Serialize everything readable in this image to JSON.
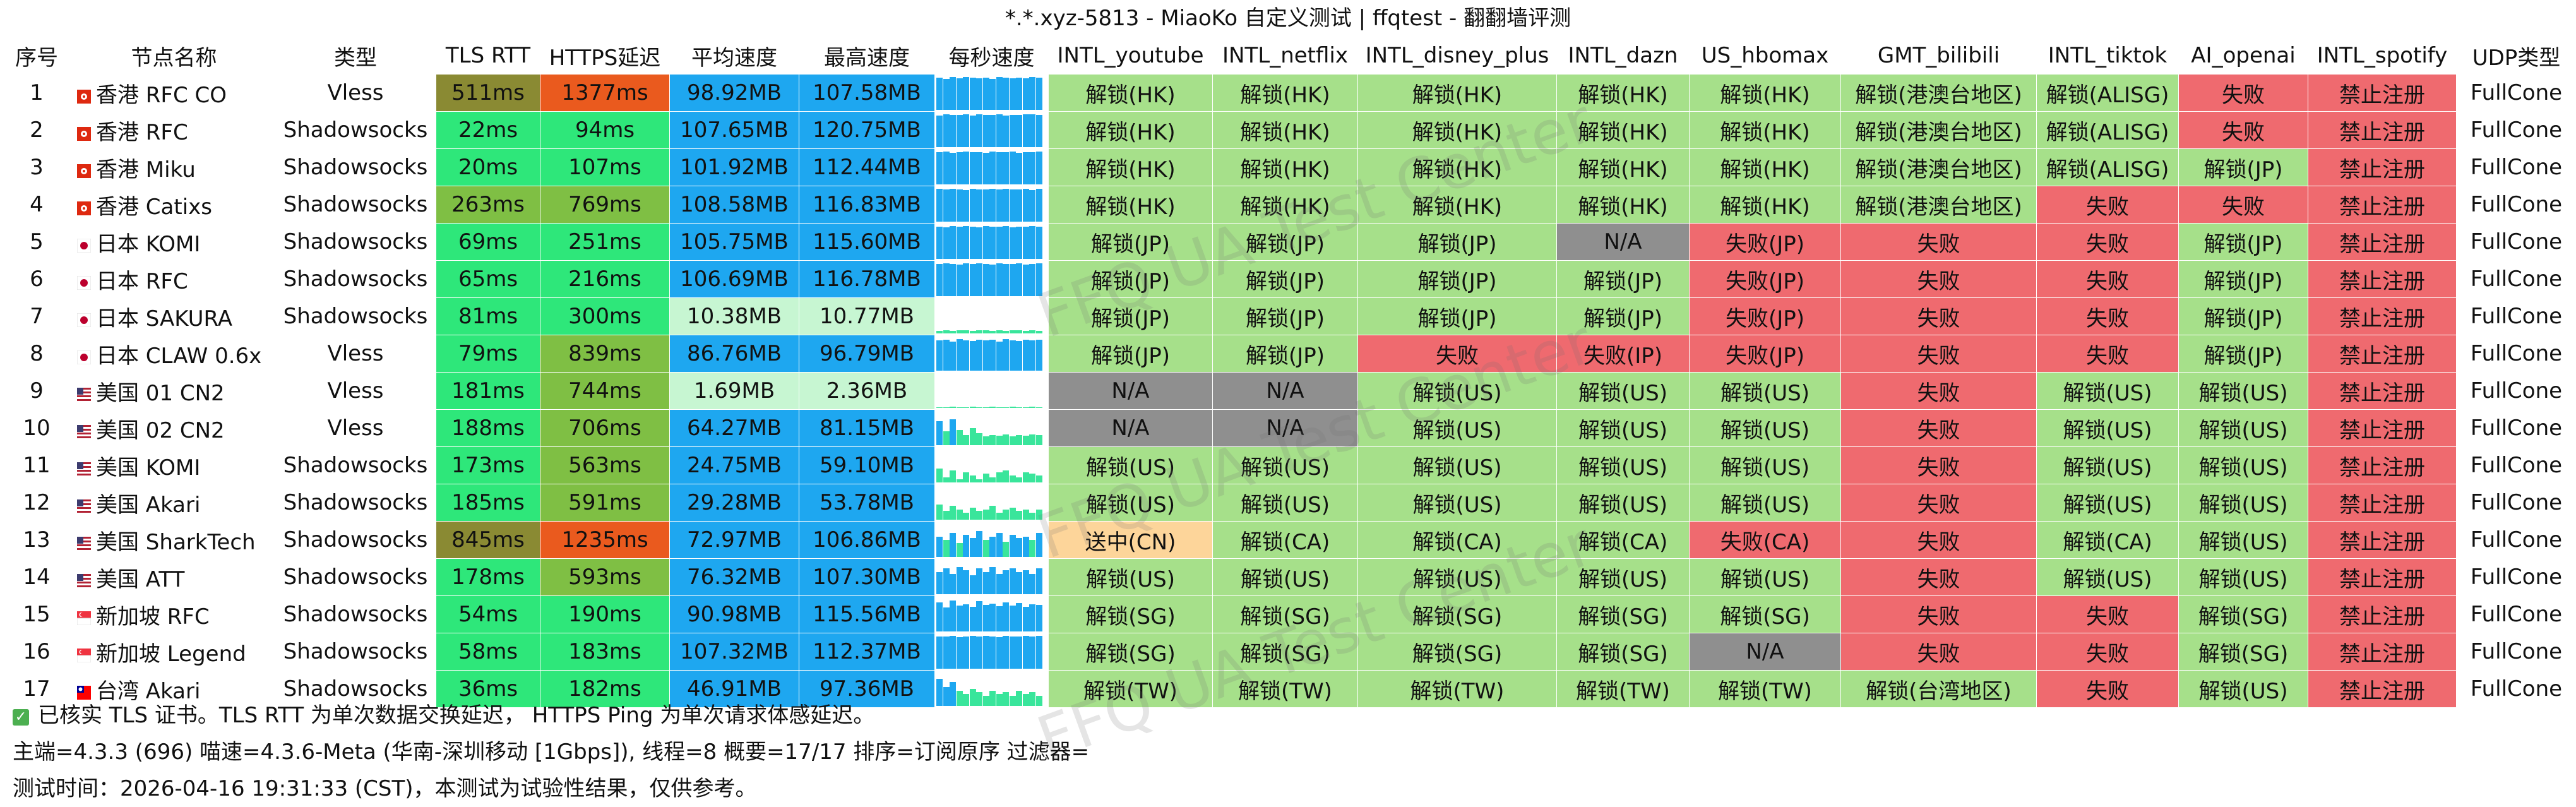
{
  "title": "*.*.xyz-5813 - MiaoKo 自定义测试 | ffqtest - 翻翻墙评测",
  "watermark": "FFQ UA Test Center",
  "colors": {
    "green_unlock": "#a6e08a",
    "red_fail": "#ef6a6f",
    "gray_na": "#8f8f8f",
    "orange_pending": "#fdd59a",
    "rtt_low": "#2ee77a",
    "rtt_mid": "#7fbf44",
    "rtt_high": "#8a8a33",
    "https_low": "#2ee77a",
    "https_mid": "#7fbf44",
    "https_high": "#ea5a1e",
    "speed_high": "#1ea7f0",
    "speed_low": "#c7f6d2",
    "spark_fast": "#1ea7f0",
    "spark_slow": "#39e59b"
  },
  "columns": [
    "序号",
    "节点名称",
    "类型",
    "TLS RTT",
    "HTTPS延迟",
    "平均速度",
    "最高速度",
    "每秒速度",
    "INTL_youtube",
    "INTL_netflix",
    "INTL_disney_plus",
    "INTL_dazn",
    "US_hbomax",
    "GMT_bilibili",
    "INTL_tiktok",
    "AI_openai",
    "INTL_spotify",
    "UDP类型"
  ],
  "rows": [
    {
      "idx": "1",
      "name": "香港 RFC CO",
      "flag": "hk-flag-icon",
      "type": "Vless",
      "rtt": "511ms",
      "rtt_level": "high",
      "https": "1377ms",
      "https_level": "high",
      "avg": "98.92MB",
      "max": "107.58MB",
      "speed_level": "high",
      "spark": [
        0.95,
        0.9,
        0.96,
        0.92,
        0.97,
        0.94,
        0.93,
        0.95,
        0.91,
        0.96,
        0.94,
        0.93,
        0.95,
        0.92,
        0.96,
        0.94
      ],
      "unlocks": [
        "解锁(HK)",
        "解锁(HK)",
        "解锁(HK)",
        "解锁(HK)",
        "解锁(HK)",
        "解锁(港澳台地区)",
        "解锁(ALISG)",
        "失败",
        "禁止注册"
      ],
      "udp": "FullCone"
    },
    {
      "idx": "2",
      "name": "香港 RFC",
      "flag": "hk-flag-icon",
      "type": "Shadowsocks",
      "rtt": "22ms",
      "rtt_level": "low",
      "https": "94ms",
      "https_level": "low",
      "avg": "107.65MB",
      "max": "120.75MB",
      "speed_level": "high",
      "spark": [
        0.92,
        0.97,
        0.94,
        0.95,
        0.96,
        0.93,
        0.97,
        0.94,
        0.95,
        0.96,
        0.93,
        0.95,
        0.94,
        0.96,
        0.97,
        0.95
      ],
      "unlocks": [
        "解锁(HK)",
        "解锁(HK)",
        "解锁(HK)",
        "解锁(HK)",
        "解锁(HK)",
        "解锁(港澳台地区)",
        "解锁(ALISG)",
        "失败",
        "禁止注册"
      ],
      "udp": "FullCone"
    },
    {
      "idx": "3",
      "name": "香港 Miku",
      "flag": "hk-flag-icon",
      "type": "Shadowsocks",
      "rtt": "20ms",
      "rtt_level": "low",
      "https": "107ms",
      "https_level": "low",
      "avg": "101.92MB",
      "max": "112.44MB",
      "speed_level": "high",
      "spark": [
        0.94,
        0.96,
        0.93,
        0.95,
        0.97,
        0.94,
        0.95,
        0.93,
        0.96,
        0.94,
        0.95,
        0.96,
        0.93,
        0.95,
        0.94,
        0.96
      ],
      "unlocks": [
        "解锁(HK)",
        "解锁(HK)",
        "解锁(HK)",
        "解锁(HK)",
        "解锁(HK)",
        "解锁(港澳台地区)",
        "解锁(ALISG)",
        "解锁(JP)",
        "禁止注册"
      ],
      "udp": "FullCone"
    },
    {
      "idx": "4",
      "name": "香港 Catixs",
      "flag": "hk-flag-icon",
      "type": "Shadowsocks",
      "rtt": "263ms",
      "rtt_level": "mid",
      "https": "769ms",
      "https_level": "mid",
      "avg": "108.58MB",
      "max": "116.83MB",
      "speed_level": "high",
      "spark": [
        0.96,
        0.94,
        0.97,
        0.95,
        0.93,
        0.96,
        0.95,
        0.94,
        0.97,
        0.95,
        0.96,
        0.94,
        0.95,
        0.97,
        0.93,
        0.96
      ],
      "unlocks": [
        "解锁(HK)",
        "解锁(HK)",
        "解锁(HK)",
        "解锁(HK)",
        "解锁(HK)",
        "解锁(港澳台地区)",
        "失败",
        "失败",
        "禁止注册"
      ],
      "udp": "FullCone"
    },
    {
      "idx": "5",
      "name": "日本 KOMI",
      "flag": "jp-flag-icon",
      "type": "Shadowsocks",
      "rtt": "69ms",
      "rtt_level": "low",
      "https": "251ms",
      "https_level": "low",
      "avg": "105.75MB",
      "max": "115.60MB",
      "speed_level": "high",
      "spark": [
        0.95,
        0.93,
        0.96,
        0.94,
        0.97,
        0.95,
        0.93,
        0.96,
        0.94,
        0.95,
        0.97,
        0.93,
        0.95,
        0.94,
        0.96,
        0.95
      ],
      "unlocks": [
        "解锁(JP)",
        "解锁(JP)",
        "解锁(JP)",
        "N/A",
        "失败(JP)",
        "失败",
        "失败",
        "解锁(JP)",
        "禁止注册"
      ],
      "udp": "FullCone"
    },
    {
      "idx": "6",
      "name": "日本 RFC",
      "flag": "jp-flag-icon",
      "type": "Shadowsocks",
      "rtt": "65ms",
      "rtt_level": "low",
      "https": "216ms",
      "https_level": "low",
      "avg": "106.69MB",
      "max": "116.78MB",
      "speed_level": "high",
      "spark": [
        0.94,
        0.96,
        0.95,
        0.93,
        0.96,
        0.94,
        0.97,
        0.95,
        0.93,
        0.96,
        0.95,
        0.94,
        0.96,
        0.93,
        0.95,
        0.96
      ],
      "unlocks": [
        "解锁(JP)",
        "解锁(JP)",
        "解锁(JP)",
        "解锁(JP)",
        "失败(JP)",
        "失败",
        "失败",
        "解锁(JP)",
        "禁止注册"
      ],
      "udp": "FullCone"
    },
    {
      "idx": "7",
      "name": "日本 SAKURA",
      "flag": "jp-flag-icon",
      "type": "Shadowsocks",
      "rtt": "81ms",
      "rtt_level": "low",
      "https": "300ms",
      "https_level": "low",
      "avg": "10.38MB",
      "max": "10.77MB",
      "speed_level": "low",
      "spark": [
        0.08,
        0.09,
        0.08,
        0.1,
        0.09,
        0.08,
        0.09,
        0.1,
        0.08,
        0.09,
        0.08,
        0.09,
        0.1,
        0.08,
        0.09,
        0.08
      ],
      "unlocks": [
        "解锁(JP)",
        "解锁(JP)",
        "解锁(JP)",
        "解锁(JP)",
        "失败(JP)",
        "失败",
        "失败",
        "解锁(JP)",
        "禁止注册"
      ],
      "udp": "FullCone"
    },
    {
      "idx": "8",
      "name": "日本 CLAW 0.6x",
      "flag": "jp-flag-icon",
      "type": "Vless",
      "rtt": "79ms",
      "rtt_level": "low",
      "https": "839ms",
      "https_level": "mid",
      "avg": "86.76MB",
      "max": "96.79MB",
      "speed_level": "high",
      "spark": [
        0.88,
        0.9,
        0.86,
        0.92,
        0.89,
        0.87,
        0.91,
        0.88,
        0.9,
        0.86,
        0.92,
        0.89,
        0.87,
        0.9,
        0.88,
        0.91
      ],
      "unlocks": [
        "解锁(JP)",
        "解锁(JP)",
        "失败",
        "失败(IP)",
        "失败(JP)",
        "失败",
        "失败",
        "解锁(JP)",
        "禁止注册"
      ],
      "udp": "FullCone"
    },
    {
      "idx": "9",
      "name": "美国 01 CN2",
      "flag": "us-flag-icon",
      "type": "Vless",
      "rtt": "181ms",
      "rtt_level": "low",
      "https": "744ms",
      "https_level": "mid",
      "avg": "1.69MB",
      "max": "2.36MB",
      "speed_level": "low",
      "spark": [
        0.02,
        0.02,
        0.03,
        0.02,
        0.02,
        0.03,
        0.02,
        0.02,
        0.03,
        0.02,
        0.02,
        0.03,
        0.02,
        0.02,
        0.03,
        0.02
      ],
      "unlocks": [
        "N/A",
        "N/A",
        "解锁(US)",
        "解锁(US)",
        "解锁(US)",
        "失败",
        "解锁(US)",
        "解锁(US)",
        "禁止注册"
      ],
      "udp": "FullCone"
    },
    {
      "idx": "10",
      "name": "美国 02 CN2",
      "flag": "us-flag-icon",
      "type": "Vless",
      "rtt": "188ms",
      "rtt_level": "low",
      "https": "706ms",
      "https_level": "mid",
      "avg": "64.27MB",
      "max": "81.15MB",
      "speed_level": "high",
      "spark": [
        0.7,
        0.4,
        0.75,
        0.45,
        0.3,
        0.5,
        0.35,
        0.25,
        0.3,
        0.28,
        0.32,
        0.26,
        0.3,
        0.27,
        0.31,
        0.29
      ],
      "unlocks": [
        "N/A",
        "N/A",
        "解锁(US)",
        "解锁(US)",
        "解锁(US)",
        "失败",
        "解锁(US)",
        "解锁(US)",
        "禁止注册"
      ],
      "udp": "FullCone"
    },
    {
      "idx": "11",
      "name": "美国 KOMI",
      "flag": "us-flag-icon",
      "type": "Shadowsocks",
      "rtt": "173ms",
      "rtt_level": "low",
      "https": "563ms",
      "https_level": "mid",
      "avg": "24.75MB",
      "max": "59.10MB",
      "speed_level": "high",
      "spark": [
        0.4,
        0.15,
        0.35,
        0.1,
        0.3,
        0.2,
        0.1,
        0.25,
        0.15,
        0.3,
        0.35,
        0.2,
        0.15,
        0.3,
        0.25,
        0.2
      ],
      "unlocks": [
        "解锁(US)",
        "解锁(US)",
        "解锁(US)",
        "解锁(US)",
        "解锁(US)",
        "失败",
        "解锁(US)",
        "解锁(US)",
        "禁止注册"
      ],
      "udp": "FullCone"
    },
    {
      "idx": "12",
      "name": "美国 Akari",
      "flag": "us-flag-icon",
      "type": "Shadowsocks",
      "rtt": "185ms",
      "rtt_level": "low",
      "https": "591ms",
      "https_level": "mid",
      "avg": "29.28MB",
      "max": "53.78MB",
      "speed_level": "high",
      "spark": [
        0.45,
        0.25,
        0.4,
        0.3,
        0.2,
        0.35,
        0.25,
        0.3,
        0.4,
        0.2,
        0.3,
        0.35,
        0.25,
        0.3,
        0.2,
        0.3
      ],
      "unlocks": [
        "解锁(US)",
        "解锁(US)",
        "解锁(US)",
        "解锁(US)",
        "解锁(US)",
        "失败",
        "解锁(US)",
        "解锁(US)",
        "禁止注册"
      ],
      "udp": "FullCone"
    },
    {
      "idx": "13",
      "name": "美国 SharkTech",
      "flag": "us-flag-icon",
      "type": "Shadowsocks",
      "rtt": "845ms",
      "rtt_level": "high",
      "https": "1235ms",
      "https_level": "high",
      "avg": "72.97MB",
      "max": "106.86MB",
      "speed_level": "high",
      "spark": [
        0.6,
        0.5,
        0.7,
        0.4,
        0.65,
        0.55,
        0.75,
        0.5,
        0.6,
        0.7,
        0.45,
        0.65,
        0.55,
        0.6,
        0.5,
        0.7
      ],
      "unlocks": [
        "送中(CN)",
        "解锁(CA)",
        "解锁(CA)",
        "解锁(CA)",
        "失败(CA)",
        "失败",
        "解锁(CA)",
        "解锁(US)",
        "禁止注册"
      ],
      "udp": "FullCone"
    },
    {
      "idx": "14",
      "name": "美国 ATT",
      "flag": "us-flag-icon",
      "type": "Shadowsocks",
      "rtt": "178ms",
      "rtt_level": "low",
      "https": "593ms",
      "https_level": "mid",
      "avg": "76.32MB",
      "max": "107.30MB",
      "speed_level": "high",
      "spark": [
        0.65,
        0.75,
        0.6,
        0.8,
        0.7,
        0.55,
        0.75,
        0.65,
        0.8,
        0.6,
        0.7,
        0.75,
        0.65,
        0.7,
        0.6,
        0.75
      ],
      "unlocks": [
        "解锁(US)",
        "解锁(US)",
        "解锁(US)",
        "解锁(US)",
        "解锁(US)",
        "失败",
        "解锁(US)",
        "解锁(US)",
        "禁止注册"
      ],
      "udp": "FullCone"
    },
    {
      "idx": "15",
      "name": "新加坡 RFC",
      "flag": "sg-flag-icon",
      "type": "Shadowsocks",
      "rtt": "54ms",
      "rtt_level": "low",
      "https": "190ms",
      "https_level": "low",
      "avg": "90.98MB",
      "max": "115.56MB",
      "speed_level": "high",
      "spark": [
        0.85,
        0.7,
        0.9,
        0.75,
        0.8,
        0.72,
        0.88,
        0.78,
        0.82,
        0.74,
        0.86,
        0.76,
        0.84,
        0.72,
        0.8,
        0.78
      ],
      "unlocks": [
        "解锁(SG)",
        "解锁(SG)",
        "解锁(SG)",
        "解锁(SG)",
        "解锁(SG)",
        "失败",
        "失败",
        "解锁(SG)",
        "禁止注册"
      ],
      "udp": "FullCone"
    },
    {
      "idx": "16",
      "name": "新加坡 Legend",
      "flag": "sg-flag-icon",
      "type": "Shadowsocks",
      "rtt": "58ms",
      "rtt_level": "low",
      "https": "183ms",
      "https_level": "low",
      "avg": "107.32MB",
      "max": "112.37MB",
      "speed_level": "high",
      "spark": [
        0.95,
        0.94,
        0.96,
        0.93,
        0.95,
        0.97,
        0.94,
        0.96,
        0.95,
        0.93,
        0.96,
        0.94,
        0.95,
        0.97,
        0.94,
        0.96
      ],
      "unlocks": [
        "解锁(SG)",
        "解锁(SG)",
        "解锁(SG)",
        "解锁(SG)",
        "N/A",
        "失败",
        "失败",
        "解锁(SG)",
        "禁止注册"
      ],
      "udp": "FullCone"
    },
    {
      "idx": "17",
      "name": "台湾 Akari",
      "flag": "tw-flag-icon",
      "type": "Shadowsocks",
      "rtt": "36ms",
      "rtt_level": "low",
      "https": "182ms",
      "https_level": "low",
      "avg": "46.91MB",
      "max": "97.36MB",
      "speed_level": "high",
      "spark": [
        0.8,
        0.55,
        0.7,
        0.45,
        0.35,
        0.5,
        0.4,
        0.3,
        0.45,
        0.35,
        0.4,
        0.3,
        0.45,
        0.35,
        0.4,
        0.3
      ],
      "unlocks": [
        "解锁(TW)",
        "解锁(TW)",
        "解锁(TW)",
        "解锁(TW)",
        "解锁(TW)",
        "解锁(台湾地区)",
        "失败",
        "解锁(US)",
        "禁止注册"
      ],
      "udp": "FullCone"
    }
  ],
  "footer": {
    "note": "已核实 TLS 证书。TLS RTT 为单次数据交换延迟， HTTPS Ping 为单次请求体感延迟。",
    "info": "主端=4.3.3 (696) 喵速=4.3.6-Meta (华南-深圳移动 [1Gbps]), 线程=8 概要=17/17 排序=订阅原序 过滤器=",
    "time": "测试时间：2026-04-16 19:31:33 (CST)，本测试为试验性结果，仅供参考。"
  }
}
